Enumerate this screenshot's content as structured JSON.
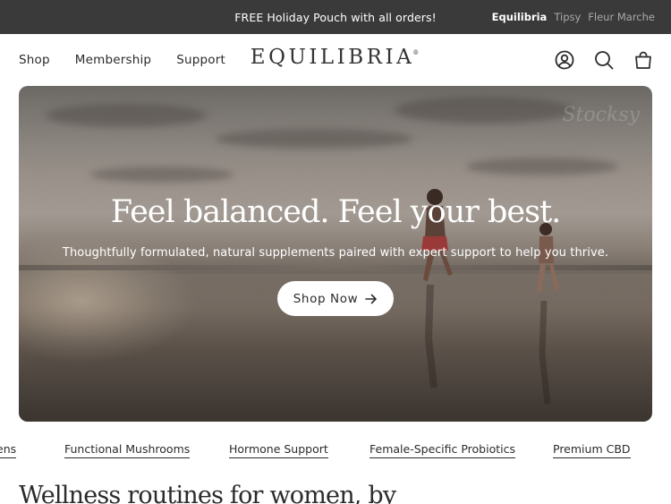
{
  "announcement": {
    "message": "FREE Holiday Pouch with all orders!",
    "brands": [
      "Equilibria",
      "Tipsy",
      "Fleur Marche"
    ],
    "active_brand": "Equilibria"
  },
  "header": {
    "nav": [
      "Shop",
      "Membership",
      "Support"
    ],
    "logo": "EQUILIBRIA",
    "logo_mark": "®",
    "icons": [
      "account-icon",
      "search-icon",
      "cart-icon"
    ]
  },
  "hero": {
    "title": "Feel balanced. Feel your best.",
    "subtitle": "Thoughtfully formulated, natural supplements paired with expert support to help you thrive.",
    "cta_label": "Shop Now",
    "cta_icon": "arrow-right-icon",
    "watermark": "Stocksy"
  },
  "categories": [
    "ens",
    "Functional Mushrooms",
    "Hormone Support",
    "Female-Specific Probiotics",
    "Premium CBD"
  ],
  "section": {
    "headline": "Wellness routines for women, by"
  },
  "colors": {
    "announcement_bg": "#3a3a3a",
    "text": "#2b2b2b",
    "muted": "#a9a9a9",
    "button_bg": "#ffffff"
  }
}
